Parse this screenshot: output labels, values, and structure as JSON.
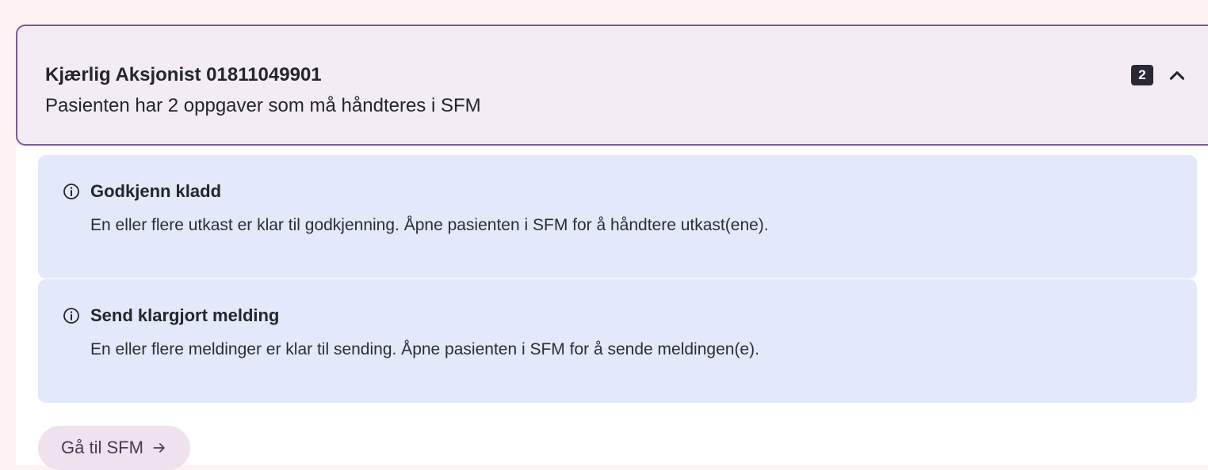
{
  "patient": {
    "name_id": "Kjærlig Aksjonist 01811049901",
    "summary": "Pasienten har 2 oppgaver som må håndteres i SFM",
    "task_count": "2",
    "expanded_icon": "chevron-up-icon"
  },
  "tasks": [
    {
      "icon": "info-icon",
      "title": "Godkjenn kladd",
      "description": "En eller flere utkast er klar til godkjenning. Åpne pasienten i SFM for å håndtere utkast(ene)."
    },
    {
      "icon": "info-icon",
      "title": "Send klargjort melding",
      "description": "En eller flere meldinger er klar til sending. Åpne pasienten i SFM for å sende meldingen(e)."
    }
  ],
  "actions": {
    "goto_label": "Gå til SFM",
    "goto_icon": "arrow-right-icon"
  },
  "colors": {
    "page_background": "#fdf1f1",
    "header_background": "#f3ecf4",
    "header_border": "#7a5a9a",
    "task_background": "#e3e8fa",
    "badge_background": "#2a2933",
    "button_background": "#efe1ee"
  }
}
